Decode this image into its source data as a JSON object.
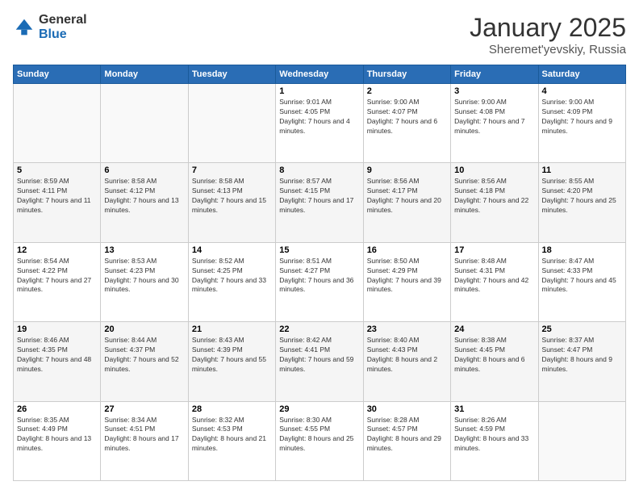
{
  "logo": {
    "general": "General",
    "blue": "Blue"
  },
  "header": {
    "month": "January 2025",
    "location": "Sheremet'yevskiy, Russia"
  },
  "weekdays": [
    "Sunday",
    "Monday",
    "Tuesday",
    "Wednesday",
    "Thursday",
    "Friday",
    "Saturday"
  ],
  "weeks": [
    [
      {
        "day": "",
        "sunrise": "",
        "sunset": "",
        "daylight": ""
      },
      {
        "day": "",
        "sunrise": "",
        "sunset": "",
        "daylight": ""
      },
      {
        "day": "",
        "sunrise": "",
        "sunset": "",
        "daylight": ""
      },
      {
        "day": "1",
        "sunrise": "Sunrise: 9:01 AM",
        "sunset": "Sunset: 4:05 PM",
        "daylight": "Daylight: 7 hours and 4 minutes."
      },
      {
        "day": "2",
        "sunrise": "Sunrise: 9:00 AM",
        "sunset": "Sunset: 4:07 PM",
        "daylight": "Daylight: 7 hours and 6 minutes."
      },
      {
        "day": "3",
        "sunrise": "Sunrise: 9:00 AM",
        "sunset": "Sunset: 4:08 PM",
        "daylight": "Daylight: 7 hours and 7 minutes."
      },
      {
        "day": "4",
        "sunrise": "Sunrise: 9:00 AM",
        "sunset": "Sunset: 4:09 PM",
        "daylight": "Daylight: 7 hours and 9 minutes."
      }
    ],
    [
      {
        "day": "5",
        "sunrise": "Sunrise: 8:59 AM",
        "sunset": "Sunset: 4:11 PM",
        "daylight": "Daylight: 7 hours and 11 minutes."
      },
      {
        "day": "6",
        "sunrise": "Sunrise: 8:58 AM",
        "sunset": "Sunset: 4:12 PM",
        "daylight": "Daylight: 7 hours and 13 minutes."
      },
      {
        "day": "7",
        "sunrise": "Sunrise: 8:58 AM",
        "sunset": "Sunset: 4:13 PM",
        "daylight": "Daylight: 7 hours and 15 minutes."
      },
      {
        "day": "8",
        "sunrise": "Sunrise: 8:57 AM",
        "sunset": "Sunset: 4:15 PM",
        "daylight": "Daylight: 7 hours and 17 minutes."
      },
      {
        "day": "9",
        "sunrise": "Sunrise: 8:56 AM",
        "sunset": "Sunset: 4:17 PM",
        "daylight": "Daylight: 7 hours and 20 minutes."
      },
      {
        "day": "10",
        "sunrise": "Sunrise: 8:56 AM",
        "sunset": "Sunset: 4:18 PM",
        "daylight": "Daylight: 7 hours and 22 minutes."
      },
      {
        "day": "11",
        "sunrise": "Sunrise: 8:55 AM",
        "sunset": "Sunset: 4:20 PM",
        "daylight": "Daylight: 7 hours and 25 minutes."
      }
    ],
    [
      {
        "day": "12",
        "sunrise": "Sunrise: 8:54 AM",
        "sunset": "Sunset: 4:22 PM",
        "daylight": "Daylight: 7 hours and 27 minutes."
      },
      {
        "day": "13",
        "sunrise": "Sunrise: 8:53 AM",
        "sunset": "Sunset: 4:23 PM",
        "daylight": "Daylight: 7 hours and 30 minutes."
      },
      {
        "day": "14",
        "sunrise": "Sunrise: 8:52 AM",
        "sunset": "Sunset: 4:25 PM",
        "daylight": "Daylight: 7 hours and 33 minutes."
      },
      {
        "day": "15",
        "sunrise": "Sunrise: 8:51 AM",
        "sunset": "Sunset: 4:27 PM",
        "daylight": "Daylight: 7 hours and 36 minutes."
      },
      {
        "day": "16",
        "sunrise": "Sunrise: 8:50 AM",
        "sunset": "Sunset: 4:29 PM",
        "daylight": "Daylight: 7 hours and 39 minutes."
      },
      {
        "day": "17",
        "sunrise": "Sunrise: 8:48 AM",
        "sunset": "Sunset: 4:31 PM",
        "daylight": "Daylight: 7 hours and 42 minutes."
      },
      {
        "day": "18",
        "sunrise": "Sunrise: 8:47 AM",
        "sunset": "Sunset: 4:33 PM",
        "daylight": "Daylight: 7 hours and 45 minutes."
      }
    ],
    [
      {
        "day": "19",
        "sunrise": "Sunrise: 8:46 AM",
        "sunset": "Sunset: 4:35 PM",
        "daylight": "Daylight: 7 hours and 48 minutes."
      },
      {
        "day": "20",
        "sunrise": "Sunrise: 8:44 AM",
        "sunset": "Sunset: 4:37 PM",
        "daylight": "Daylight: 7 hours and 52 minutes."
      },
      {
        "day": "21",
        "sunrise": "Sunrise: 8:43 AM",
        "sunset": "Sunset: 4:39 PM",
        "daylight": "Daylight: 7 hours and 55 minutes."
      },
      {
        "day": "22",
        "sunrise": "Sunrise: 8:42 AM",
        "sunset": "Sunset: 4:41 PM",
        "daylight": "Daylight: 7 hours and 59 minutes."
      },
      {
        "day": "23",
        "sunrise": "Sunrise: 8:40 AM",
        "sunset": "Sunset: 4:43 PM",
        "daylight": "Daylight: 8 hours and 2 minutes."
      },
      {
        "day": "24",
        "sunrise": "Sunrise: 8:38 AM",
        "sunset": "Sunset: 4:45 PM",
        "daylight": "Daylight: 8 hours and 6 minutes."
      },
      {
        "day": "25",
        "sunrise": "Sunrise: 8:37 AM",
        "sunset": "Sunset: 4:47 PM",
        "daylight": "Daylight: 8 hours and 9 minutes."
      }
    ],
    [
      {
        "day": "26",
        "sunrise": "Sunrise: 8:35 AM",
        "sunset": "Sunset: 4:49 PM",
        "daylight": "Daylight: 8 hours and 13 minutes."
      },
      {
        "day": "27",
        "sunrise": "Sunrise: 8:34 AM",
        "sunset": "Sunset: 4:51 PM",
        "daylight": "Daylight: 8 hours and 17 minutes."
      },
      {
        "day": "28",
        "sunrise": "Sunrise: 8:32 AM",
        "sunset": "Sunset: 4:53 PM",
        "daylight": "Daylight: 8 hours and 21 minutes."
      },
      {
        "day": "29",
        "sunrise": "Sunrise: 8:30 AM",
        "sunset": "Sunset: 4:55 PM",
        "daylight": "Daylight: 8 hours and 25 minutes."
      },
      {
        "day": "30",
        "sunrise": "Sunrise: 8:28 AM",
        "sunset": "Sunset: 4:57 PM",
        "daylight": "Daylight: 8 hours and 29 minutes."
      },
      {
        "day": "31",
        "sunrise": "Sunrise: 8:26 AM",
        "sunset": "Sunset: 4:59 PM",
        "daylight": "Daylight: 8 hours and 33 minutes."
      },
      {
        "day": "",
        "sunrise": "",
        "sunset": "",
        "daylight": ""
      }
    ]
  ]
}
